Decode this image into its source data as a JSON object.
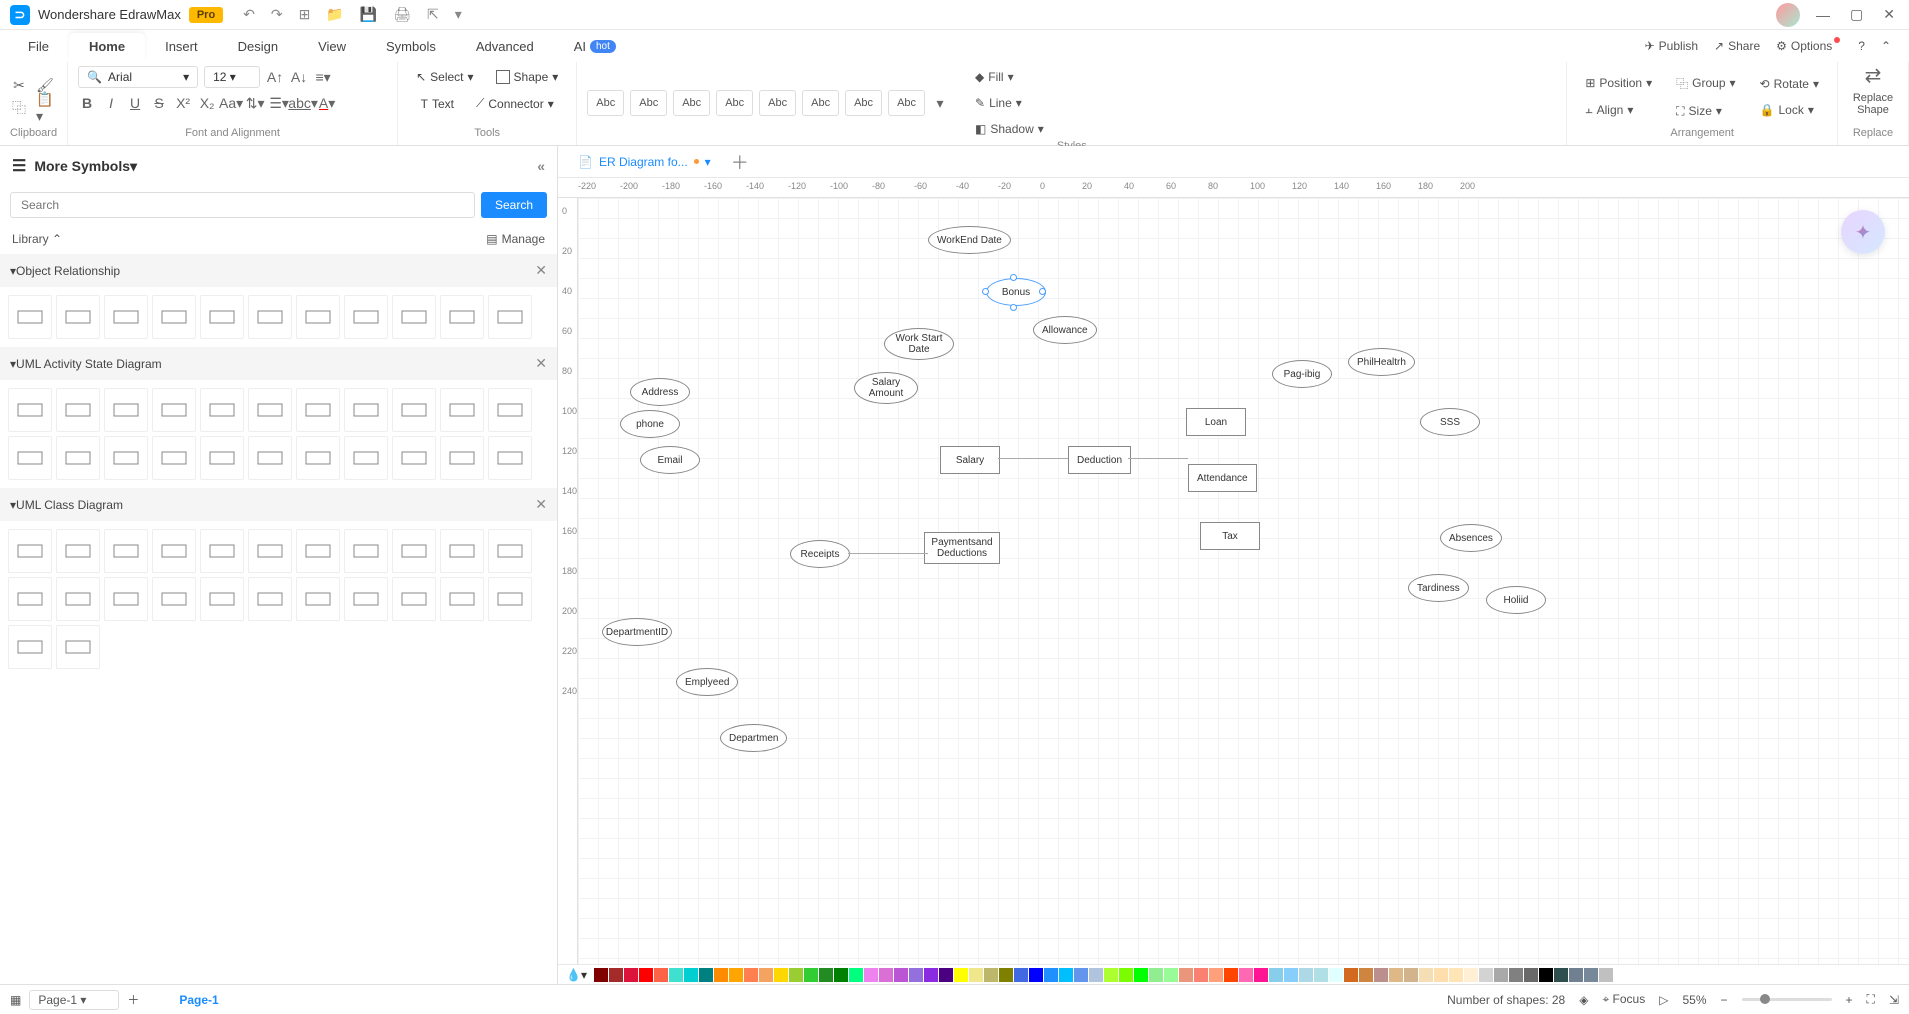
{
  "titlebar": {
    "app": "Wondershare EdrawMax",
    "pro": "Pro"
  },
  "menu": {
    "tabs": [
      "File",
      "Home",
      "Insert",
      "Design",
      "View",
      "Symbols",
      "Advanced"
    ],
    "ai": "AI",
    "hot": "hot",
    "publish": "Publish",
    "share": "Share",
    "options": "Options"
  },
  "ribbon": {
    "clipboard": "Clipboard",
    "font": "Font and Alignment",
    "font_name": "Arial",
    "font_size": "12",
    "tools": "Tools",
    "select": "Select",
    "text": "Text",
    "shape": "Shape",
    "connector": "Connector",
    "styles": "Styles",
    "abc": "Abc",
    "fill": "Fill",
    "line": "Line",
    "shadow": "Shadow",
    "arrangement": "Arrangement",
    "position": "Position",
    "align": "Align",
    "group": "Group",
    "size": "Size",
    "rotate": "Rotate",
    "lock": "Lock",
    "replace": "Replace",
    "replace_shape": "Replace Shape"
  },
  "left": {
    "title": "More Symbols",
    "search": "Search",
    "search_ph": "Search",
    "library": "Library",
    "manage": "Manage",
    "sec1": "Object Relationship",
    "sec2": "UML Activity State Diagram",
    "sec3": "UML Class Diagram"
  },
  "doc": {
    "tab": "ER Diagram fo..."
  },
  "ruler_h": [
    "-220",
    "-200",
    "-180",
    "-160",
    "-140",
    "-120",
    "-100",
    "-80",
    "-60",
    "-40",
    "-20",
    "0",
    "20",
    "40",
    "60",
    "80",
    "100",
    "120",
    "140",
    "160",
    "180",
    "200"
  ],
  "ruler_v": [
    "0",
    "20",
    "40",
    "60",
    "80",
    "100",
    "120",
    "140",
    "160",
    "180",
    "200",
    "220",
    "240"
  ],
  "shapes": {
    "workend": "WorkEnd Date",
    "bonus": "Bonus",
    "allowance": "Allowance",
    "workstart": "Work Start Date",
    "philhealth": "PhilHealtrh",
    "pagibig": "Pag-ibig",
    "address": "Address",
    "phone": "phone",
    "salaryamt": "Salary Amount",
    "loan": "Loan",
    "sss": "SSS",
    "email": "Email",
    "salary": "Salary",
    "deduction": "Deduction",
    "attendance": "Attendance",
    "tax": "Tax",
    "absences": "Absences",
    "receipts": "Receipts",
    "payments": "Paymentsand Deductions",
    "tardiness": "Tardiness",
    "holiday": "Holiid",
    "deptid": "DepartmentID",
    "employed": "Emplyeed",
    "department": "Departmen"
  },
  "status": {
    "page": "Page-1",
    "pagetab": "Page-1",
    "shapes": "Number of shapes: 28",
    "focus": "Focus",
    "zoom": "55%"
  },
  "colors": [
    "#800000",
    "#a52a2a",
    "#dc143c",
    "#ff0000",
    "#ff6347",
    "#40e0d0",
    "#00ced1",
    "#008080",
    "#ff8c00",
    "#ffa500",
    "#ff7f50",
    "#f4a460",
    "#ffd700",
    "#9acd32",
    "#32cd32",
    "#228b22",
    "#008000",
    "#00ff7f",
    "#ee82ee",
    "#da70d6",
    "#ba55d3",
    "#9370db",
    "#8a2be2",
    "#4b0082",
    "#ffff00",
    "#f0e68c",
    "#bdb76b",
    "#808000",
    "#4169e1",
    "#0000ff",
    "#1e90ff",
    "#00bfff",
    "#6495ed",
    "#b0c4de",
    "#adff2f",
    "#7cfc00",
    "#00ff00",
    "#90ee90",
    "#98fb98",
    "#e9967a",
    "#fa8072",
    "#ffa07a",
    "#ff4500",
    "#ff69b4",
    "#ff1493",
    "#87ceeb",
    "#87cefa",
    "#add8e6",
    "#b0e0e6",
    "#e0ffff",
    "#d2691e",
    "#cd853f",
    "#bc8f8f",
    "#deb887",
    "#d2b48c",
    "#f5deb3",
    "#ffdead",
    "#ffe4b5",
    "#ffefd5",
    "#d3d3d3",
    "#a9a9a9",
    "#808080",
    "#696969",
    "#000000",
    "#2f4f4f",
    "#708090",
    "#778899",
    "#c0c0c0"
  ]
}
